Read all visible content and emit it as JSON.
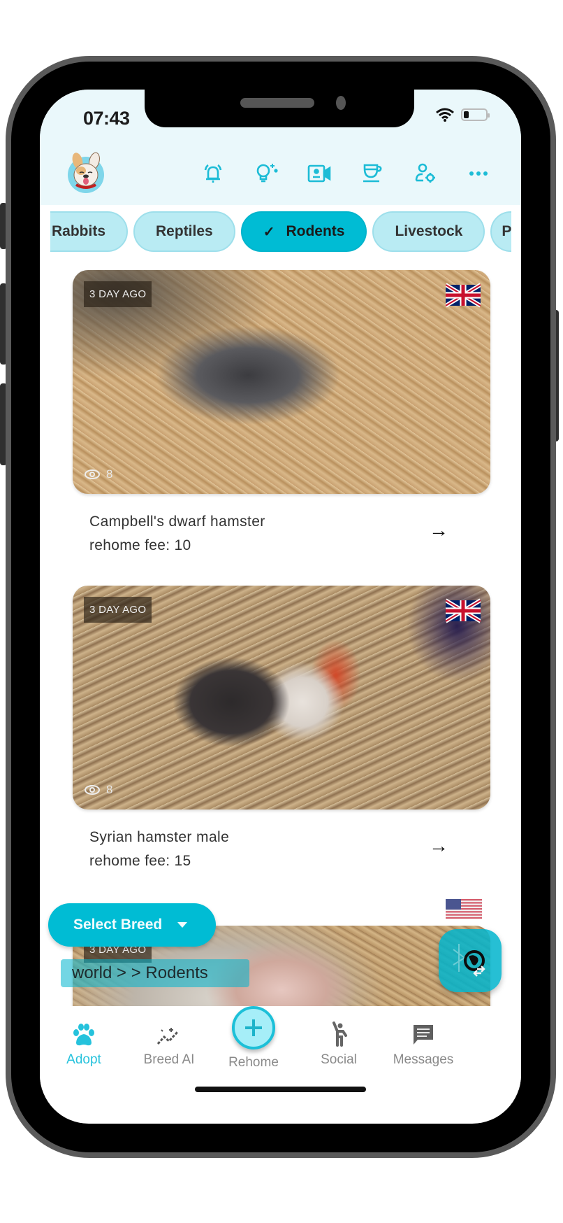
{
  "status_bar": {
    "time": "07:43",
    "battery_level_fraction": 0.15
  },
  "header": {
    "avatar": "french-bulldog-logo",
    "icons": [
      {
        "name": "bell-ringing-icon",
        "label": "Notifications"
      },
      {
        "name": "lightbulb-sparkle-icon",
        "label": "Ideas"
      },
      {
        "name": "video-contact-icon",
        "label": "Video"
      },
      {
        "name": "teacup-icon",
        "label": "Cafe"
      },
      {
        "name": "user-settings-icon",
        "label": "Account settings"
      },
      {
        "name": "more-horizontal-icon",
        "label": "More"
      }
    ]
  },
  "category_tabs": [
    {
      "label": "Rabbits",
      "active": false
    },
    {
      "label": "Reptiles",
      "active": false
    },
    {
      "label": "Rodents",
      "active": true
    },
    {
      "label": "Livestock",
      "active": false
    },
    {
      "label": "P",
      "active": false
    }
  ],
  "listings": [
    {
      "posted": "3 DAY AGO",
      "flag": "UK",
      "views": "8",
      "title": " Campbell's dwarf hamster",
      "fee": "rehome fee: 10",
      "arrow": "→"
    },
    {
      "posted": "3 DAY AGO",
      "flag": "UK",
      "views": "8",
      "title": "Syrian hamster male",
      "fee": "rehome fee: 15",
      "arrow": "→"
    },
    {
      "posted": "3 DAY AGO",
      "flag": "US"
    }
  ],
  "filter": {
    "select_breed_label": "Select Breed",
    "breadcrumb": "world >  > Rodents"
  },
  "bottom_nav": [
    {
      "label": "Adopt",
      "icon": "paw-icon",
      "active": true
    },
    {
      "label": "Breed AI",
      "icon": "sparkle-chart-icon",
      "active": false
    },
    {
      "label": "Rehome",
      "icon": "plus-circle-icon",
      "active": false
    },
    {
      "label": "Social",
      "icon": "person-waving-icon",
      "active": false
    },
    {
      "label": "Messages",
      "icon": "message-icon",
      "active": false
    }
  ],
  "colors": {
    "accent": "#00bcd4",
    "chip_inactive": "#b9ebf3",
    "header_bg": "#eaf8fb",
    "nav_inactive": "#8a8a8a"
  }
}
